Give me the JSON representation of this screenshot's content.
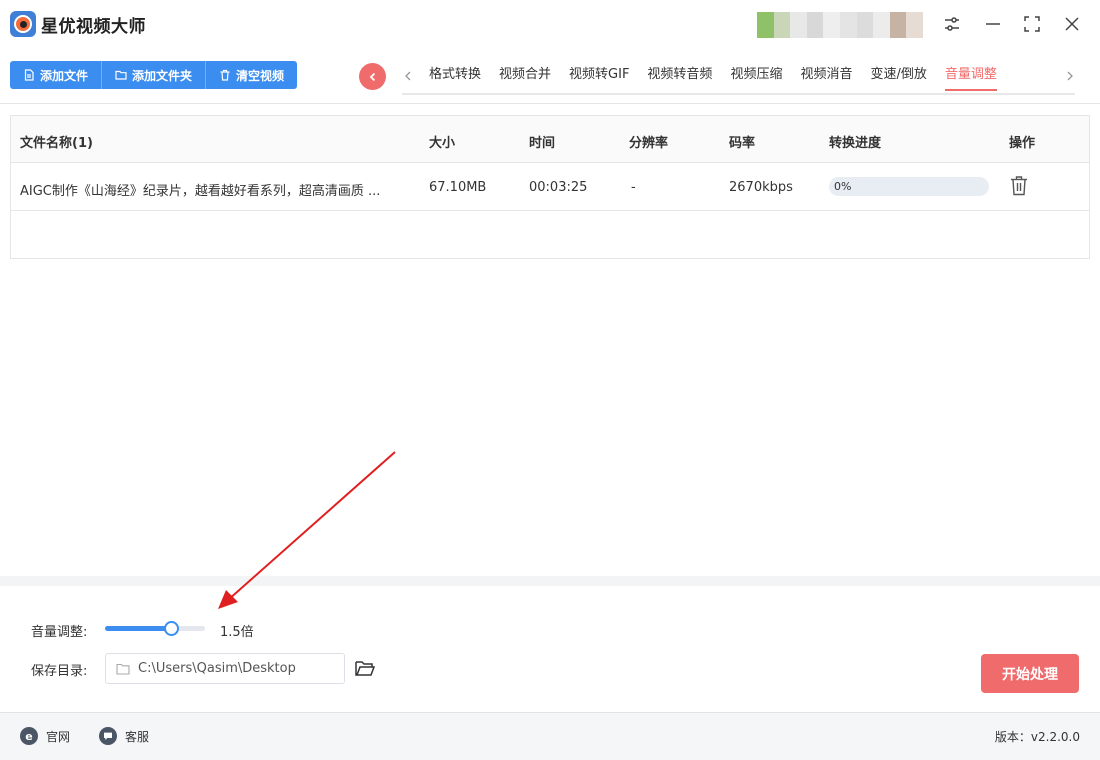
{
  "app": {
    "title": "星优视频大师"
  },
  "toolbar": {
    "buttons": [
      {
        "label": "添加文件",
        "icon": "file-icon"
      },
      {
        "label": "添加文件夹",
        "icon": "folder-icon"
      },
      {
        "label": "清空视频",
        "icon": "trash-icon"
      }
    ]
  },
  "tabs": [
    {
      "label": "格式转换"
    },
    {
      "label": "视频合并"
    },
    {
      "label": "视频转GIF"
    },
    {
      "label": "视频转音频"
    },
    {
      "label": "视频压缩"
    },
    {
      "label": "视频消音"
    },
    {
      "label": "变速/倒放"
    },
    {
      "label": "音量调整",
      "active": true
    }
  ],
  "table": {
    "headers": {
      "name": "文件名称(1)",
      "size": "大小",
      "time": "时间",
      "resolution": "分辨率",
      "bitrate": "码率",
      "progress": "转换进度",
      "action": "操作"
    },
    "rows": [
      {
        "name": "AIGC制作《山海经》纪录片，越看越好看系列，超高清画质 ...",
        "size": "67.10MB",
        "time": "00:03:25",
        "resolution": "-",
        "bitrate": "2670kbps",
        "progress_text": "0%",
        "progress": 0
      }
    ]
  },
  "settings": {
    "volume_label": "音量调整:",
    "volume_value_text": "1.5倍",
    "volume_fraction": 0.67,
    "save_dir_label": "保存目录:",
    "save_dir_value": "C:\\Users\\Qasim\\Desktop",
    "start_button": "开始处理"
  },
  "footer": {
    "website": "官网",
    "website_icon_letter": "e",
    "support": "客服",
    "version": "版本：v2.2.0.0"
  },
  "colors": {
    "accent_blue": "#3b8ef0",
    "accent_red": "#f06b6b",
    "annotation_red": "#e02020"
  }
}
